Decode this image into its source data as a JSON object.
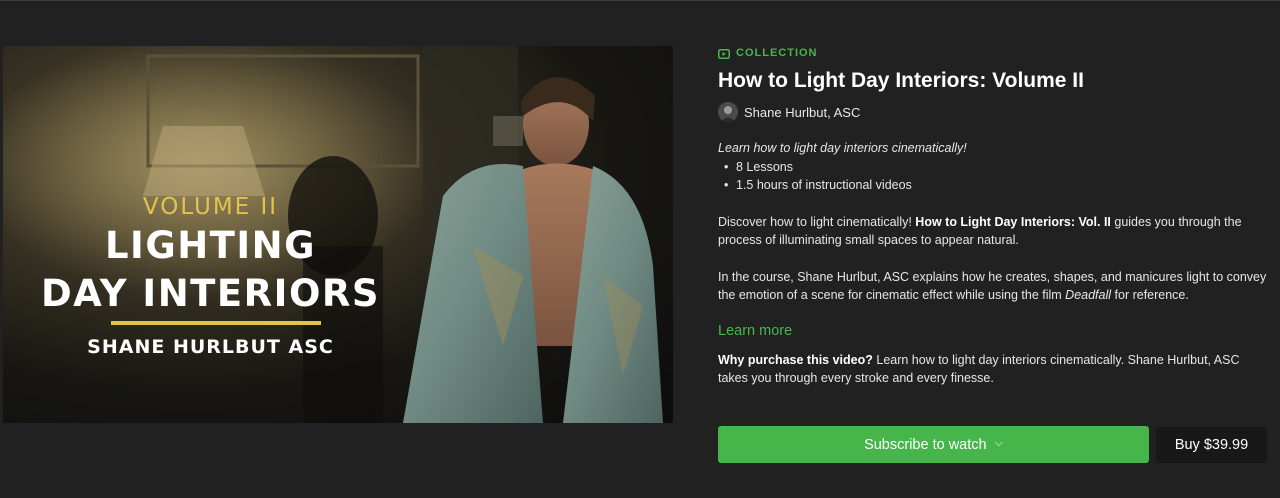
{
  "hero": {
    "volume": "VOLUME II",
    "title_line1": "LIGHTING",
    "title_line2": "DAY INTERIORS",
    "author": "SHANE HURLBUT ASC",
    "accent_color": "#e5c24c"
  },
  "collection_label": "COLLECTION",
  "course_title": "How to Light Day Interiors: Volume II",
  "author_name": "Shane Hurlbut, ASC",
  "tagline": "Learn how to light day interiors cinematically!",
  "bullets": [
    "8 Lessons",
    "1.5 hours of instructional videos"
  ],
  "para1": {
    "before": "Discover how to light cinematically! ",
    "bold": "How to Light Day Interiors: Vol. II",
    "after": " guides you through the process of illuminating small spaces to appear natural."
  },
  "para2": {
    "before": "In the course, Shane Hurlbut, ASC explains how he creates, shapes, and manicures light to convey the emotion of a scene for cinematic effect while using the film ",
    "italic": "Deadfall",
    "after": " for reference."
  },
  "learn_more": "Learn more",
  "why": {
    "bold": "Why purchase this video?",
    "text": " Learn how to light day interiors cinematically. Shane Hurlbut, ASC takes you through every stroke and every finesse."
  },
  "subscribe_label": "Subscribe to watch",
  "buy_label": "Buy $39.99",
  "colors": {
    "accent_green": "#46b54a",
    "background": "#212121"
  }
}
